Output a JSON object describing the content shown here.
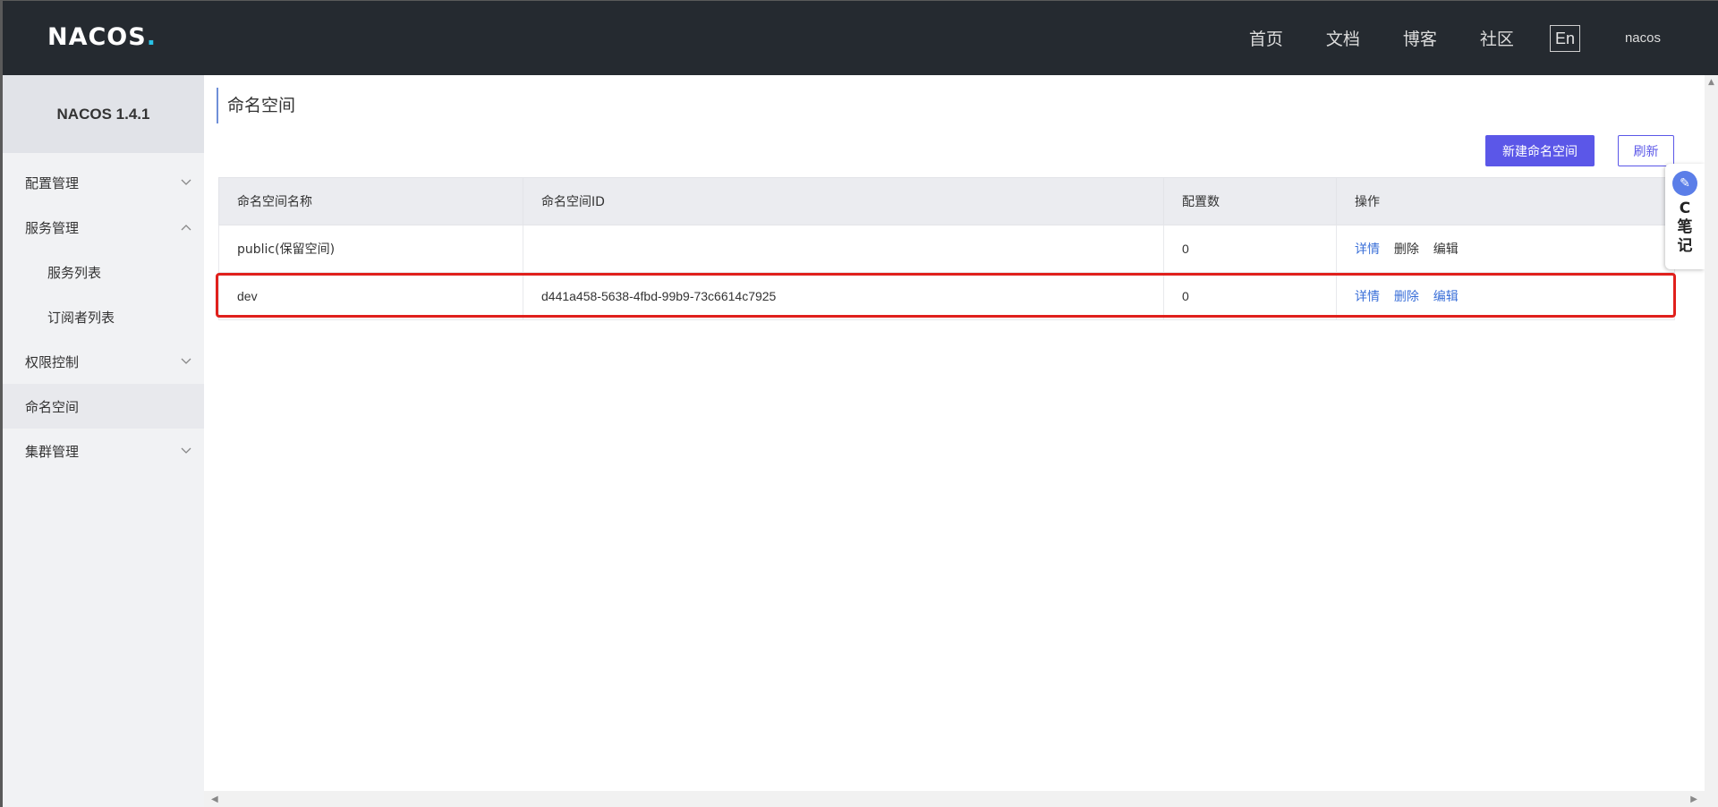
{
  "header": {
    "logo_text": "NACOS",
    "logo_dot": ".",
    "nav": [
      "首页",
      "文档",
      "博客",
      "社区"
    ],
    "lang_label": "En",
    "username": "nacos"
  },
  "sidebar": {
    "version": "NACOS 1.4.1",
    "items": [
      {
        "label": "配置管理",
        "chevron": "down"
      },
      {
        "label": "服务管理",
        "chevron": "up"
      },
      {
        "label": "服务列表",
        "chevron": ""
      },
      {
        "label": "订阅者列表",
        "chevron": ""
      },
      {
        "label": "权限控制",
        "chevron": "down"
      },
      {
        "label": "命名空间",
        "chevron": ""
      },
      {
        "label": "集群管理",
        "chevron": "down"
      }
    ]
  },
  "main": {
    "title": "命名空间",
    "create_button": "新建命名空间",
    "refresh_button": "刷新",
    "table": {
      "columns": [
        "命名空间名称",
        "命名空间ID",
        "配置数",
        "操作"
      ],
      "rows": [
        {
          "name": "public(保留空间)",
          "id": "",
          "count": "0",
          "actions": [
            "详情",
            "删除",
            "编辑"
          ]
        },
        {
          "name": "dev",
          "id": "d441a458-5638-4fbd-99b9-73c6614c7925",
          "count": "0",
          "actions": [
            "详情",
            "删除",
            "编辑"
          ]
        }
      ]
    }
  },
  "note_widget": {
    "text": "C笔记",
    "icon": "pen-icon"
  },
  "colors": {
    "header_bg": "#252a30",
    "primary": "#5b57e8",
    "link": "#3a6fd8",
    "highlight": "#e0201c"
  }
}
